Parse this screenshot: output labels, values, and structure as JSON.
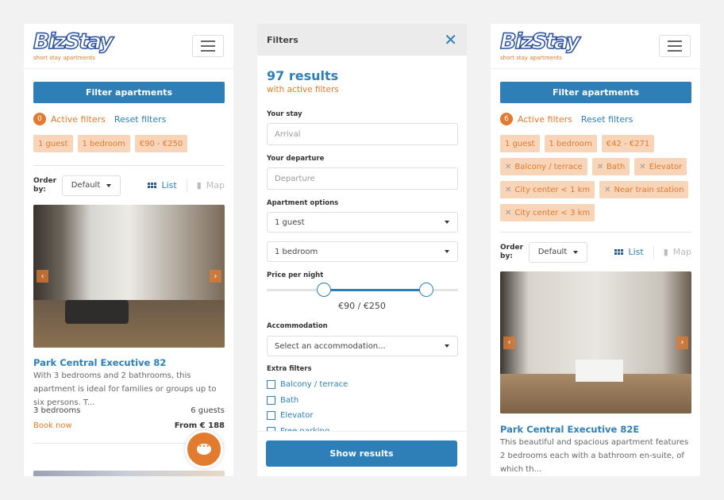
{
  "brand": {
    "logo_text": "BizStay",
    "tagline": "short stay apartments"
  },
  "left": {
    "filter_button": "Filter apartments",
    "active_count": "0",
    "active_label": "Active filters",
    "reset_label": "Reset filters",
    "chips": [
      "1 guest",
      "1 bedroom",
      "€90 - €250"
    ],
    "order_label": "Order by:",
    "order_value": "Default",
    "list_label": "List",
    "map_label": "Map",
    "listing": {
      "title": "Park Central Executive 82",
      "description": "With 3 bedrooms and 2 bathrooms, this apartment is ideal for families or groups up to six persons. T...",
      "bedrooms": "3 bedrooms",
      "guests": "6 guests",
      "book": "Book now",
      "price": "From € 188"
    }
  },
  "filters": {
    "title": "Filters",
    "results": "97 results",
    "results_sub": "with active filters",
    "stay_label": "Your stay",
    "arrival_placeholder": "Arrival",
    "departure_label": "Your departure",
    "departure_placeholder": "Departure",
    "options_label": "Apartment options",
    "guests_value": "1 guest",
    "bedrooms_value": "1 bedroom",
    "price_label": "Price per night",
    "price_value": "€90 / €250",
    "price_min": 90,
    "price_max": 250,
    "accommodation_label": "Accommodation",
    "accommodation_value": "Select an accommodation...",
    "extra_label": "Extra filters",
    "extras": [
      "Balcony / terrace",
      "Bath",
      "Elevator",
      "Free parking"
    ],
    "show_button": "Show results"
  },
  "right": {
    "filter_button": "Filter apartments",
    "active_count": "6",
    "active_label": "Active filters",
    "reset_label": "Reset filters",
    "chips": [
      "1 guest",
      "1 bedroom",
      "€42 - €271"
    ],
    "removable_chips": [
      "Balcony / terrace",
      "Bath",
      "Elevator",
      "City center < 1 km",
      "Near train station",
      "City center < 3 km"
    ],
    "order_label": "Order by:",
    "order_value": "Default",
    "list_label": "List",
    "map_label": "Map",
    "listing": {
      "title": "Park Central Executive 82E",
      "description": "This beautiful and spacious apartment features 2 bedrooms each with a bathroom en-suite, of which th..."
    }
  },
  "colors": {
    "primary": "#2e7fb8",
    "accent": "#e07b30",
    "chip_bg": "#f8d4b8"
  }
}
